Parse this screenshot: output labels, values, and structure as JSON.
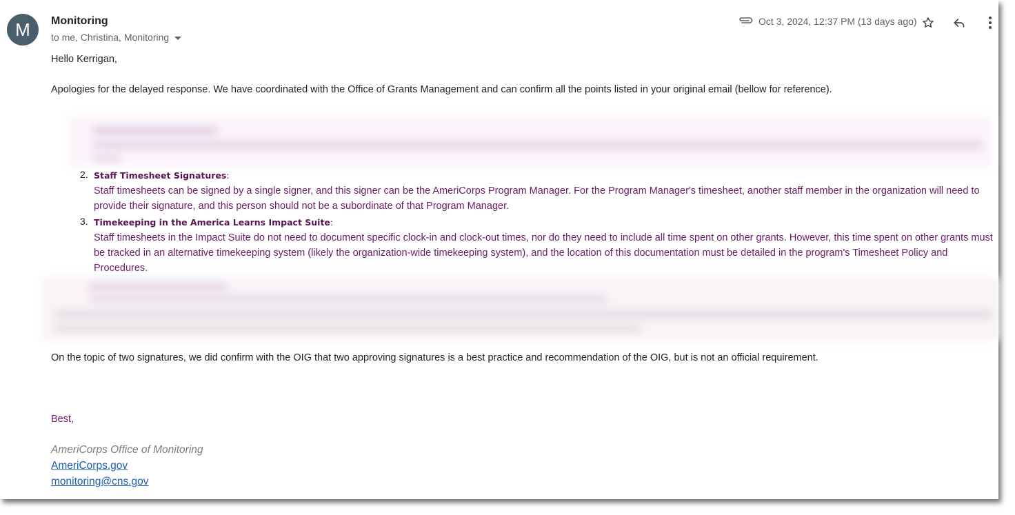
{
  "sender": {
    "avatar_letter": "M",
    "name": "Monitoring",
    "recipients": "to me, Christina, Monitoring"
  },
  "meta": {
    "date": "Oct 3, 2024, 12:37 PM (13 days ago)"
  },
  "icons": {
    "attachment": "paperclip-icon",
    "star": "star-icon",
    "reply": "reply-icon",
    "more": "more-vert-icon"
  },
  "body": {
    "greeting": "Hello Kerrigan,",
    "intro": "Apologies for the delayed response. We have coordinated with the Office of Grants Management and can confirm all the points listed in your original email (bellow for reference).",
    "points": [
      {
        "number": "2.",
        "title": "Staff Timesheet Signatures",
        "text": "Staff timesheets can be signed by a single signer, and this signer can be the AmeriCorps Program Manager. For the Program Manager's timesheet, another staff member in the organization will need to provide their signature, and this person should not be a subordinate of that Program Manager."
      },
      {
        "number": "3.",
        "title": "Timekeeping in the America Learns Impact Suite",
        "text": "Staff timesheets in the Impact Suite do not need to document specific clock-in and clock-out times, nor do they need to include all time spent on other grants. However, this time spent on other grants must be tracked in an alternative timekeeping system (likely the organization-wide timekeeping system), and the location of this documentation must be detailed in the program's Timesheet Policy and Procedures."
      }
    ],
    "oig_note": "On the topic of two signatures, we did confirm with the OIG that two approving signatures is a best practice and recommendation of the OIG, but is not an official requirement.",
    "closing": "Best,"
  },
  "signature": {
    "office": "AmeriCorps Office of Monitoring",
    "website": "AmeriCorps.gov",
    "email": "monitoring@cns.gov"
  },
  "colors": {
    "avatar_bg": "#4a5d6a",
    "quote_purple": "#6b1a66",
    "link_blue": "#1a5fb4"
  }
}
